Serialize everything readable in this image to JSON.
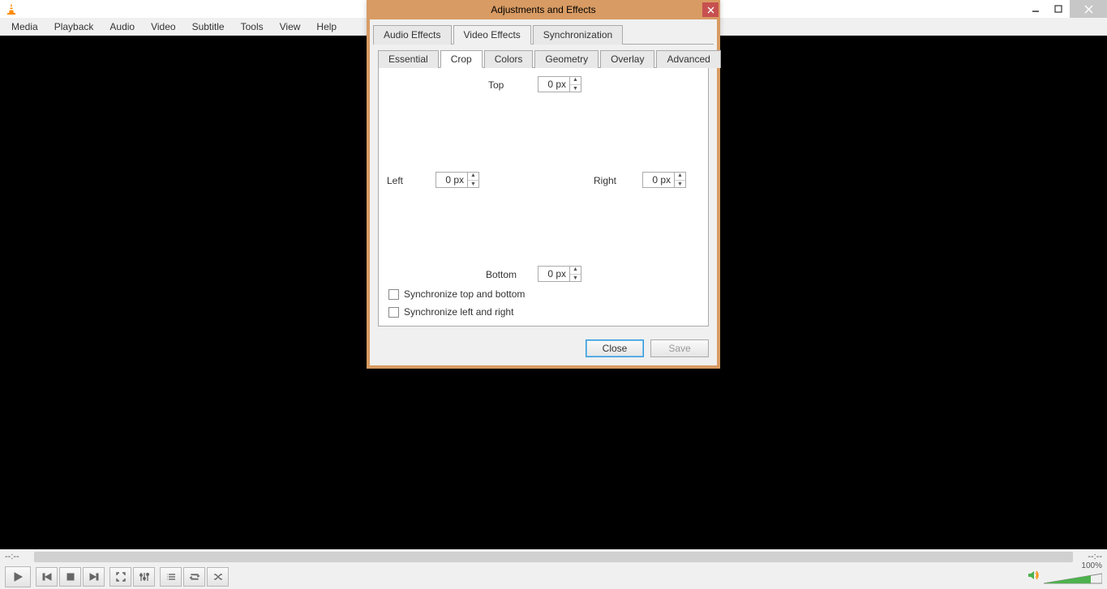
{
  "menu": {
    "items": [
      "Media",
      "Playback",
      "Audio",
      "Video",
      "Subtitle",
      "Tools",
      "View",
      "Help"
    ]
  },
  "player": {
    "time_left": "--:--",
    "time_right": "--:--",
    "volume_pct": "100%"
  },
  "dialog": {
    "title": "Adjustments and Effects",
    "tabs": [
      "Audio Effects",
      "Video Effects",
      "Synchronization"
    ],
    "active_tab": 1,
    "subtabs": [
      "Essential",
      "Crop",
      "Colors",
      "Geometry",
      "Overlay",
      "Advanced"
    ],
    "active_subtab": 1,
    "crop": {
      "top_label": "Top",
      "top_val": "0 px",
      "left_label": "Left",
      "left_val": "0 px",
      "right_label": "Right",
      "right_val": "0 px",
      "bottom_label": "Bottom",
      "bottom_val": "0 px",
      "sync_tb": "Synchronize top and bottom",
      "sync_lr": "Synchronize left and right"
    },
    "buttons": {
      "close": "Close",
      "save": "Save"
    }
  }
}
